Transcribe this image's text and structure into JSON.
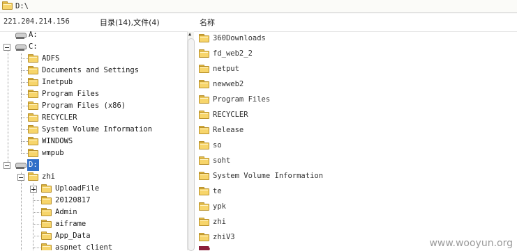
{
  "path_bar": {
    "path": "D:\\"
  },
  "header": {
    "ip": "221.204.214.156",
    "summary": "目录(14),文件(4)",
    "name_column": "名称"
  },
  "tree": {
    "nodes": [
      {
        "label": "A:",
        "icon": "drive-icon"
      },
      {
        "label": "C:",
        "icon": "drive-icon"
      },
      {
        "label": "ADFS",
        "icon": "folder-icon"
      },
      {
        "label": "Documents and Settings",
        "icon": "folder-icon"
      },
      {
        "label": "Inetpub",
        "icon": "folder-icon"
      },
      {
        "label": "Program Files",
        "icon": "folder-icon"
      },
      {
        "label": "Program Files (x86)",
        "icon": "folder-icon"
      },
      {
        "label": "RECYCLER",
        "icon": "folder-icon"
      },
      {
        "label": "System Volume Information",
        "icon": "folder-icon"
      },
      {
        "label": "WINDOWS",
        "icon": "folder-icon"
      },
      {
        "label": "wmpub",
        "icon": "folder-icon"
      },
      {
        "label": "D:",
        "icon": "drive-icon",
        "selected": true
      },
      {
        "label": "zhi",
        "icon": "folder-icon"
      },
      {
        "label": "UploadFile",
        "icon": "folder-icon"
      },
      {
        "label": "20120817",
        "icon": "folder-icon"
      },
      {
        "label": "Admin",
        "icon": "folder-icon"
      },
      {
        "label": "aiframe",
        "icon": "folder-icon"
      },
      {
        "label": "App_Data",
        "icon": "folder-icon"
      },
      {
        "label": "aspnet_client",
        "icon": "folder-icon"
      }
    ]
  },
  "file_list": {
    "items": [
      {
        "name": "360Downloads"
      },
      {
        "name": "fd_web2_2"
      },
      {
        "name": "netput"
      },
      {
        "name": "newweb2"
      },
      {
        "name": "Program Files"
      },
      {
        "name": "RECYCLER"
      },
      {
        "name": "Release"
      },
      {
        "name": "so"
      },
      {
        "name": "soht"
      },
      {
        "name": "System Volume Information"
      },
      {
        "name": "te"
      },
      {
        "name": "ypk"
      },
      {
        "name": "zhi"
      },
      {
        "name": "zhiV3"
      }
    ]
  },
  "watermark": "www.wooyun.org",
  "colors": {
    "selection": "#2f6ec8",
    "folder": "#f7d56b",
    "folder_border": "#b8902a"
  }
}
